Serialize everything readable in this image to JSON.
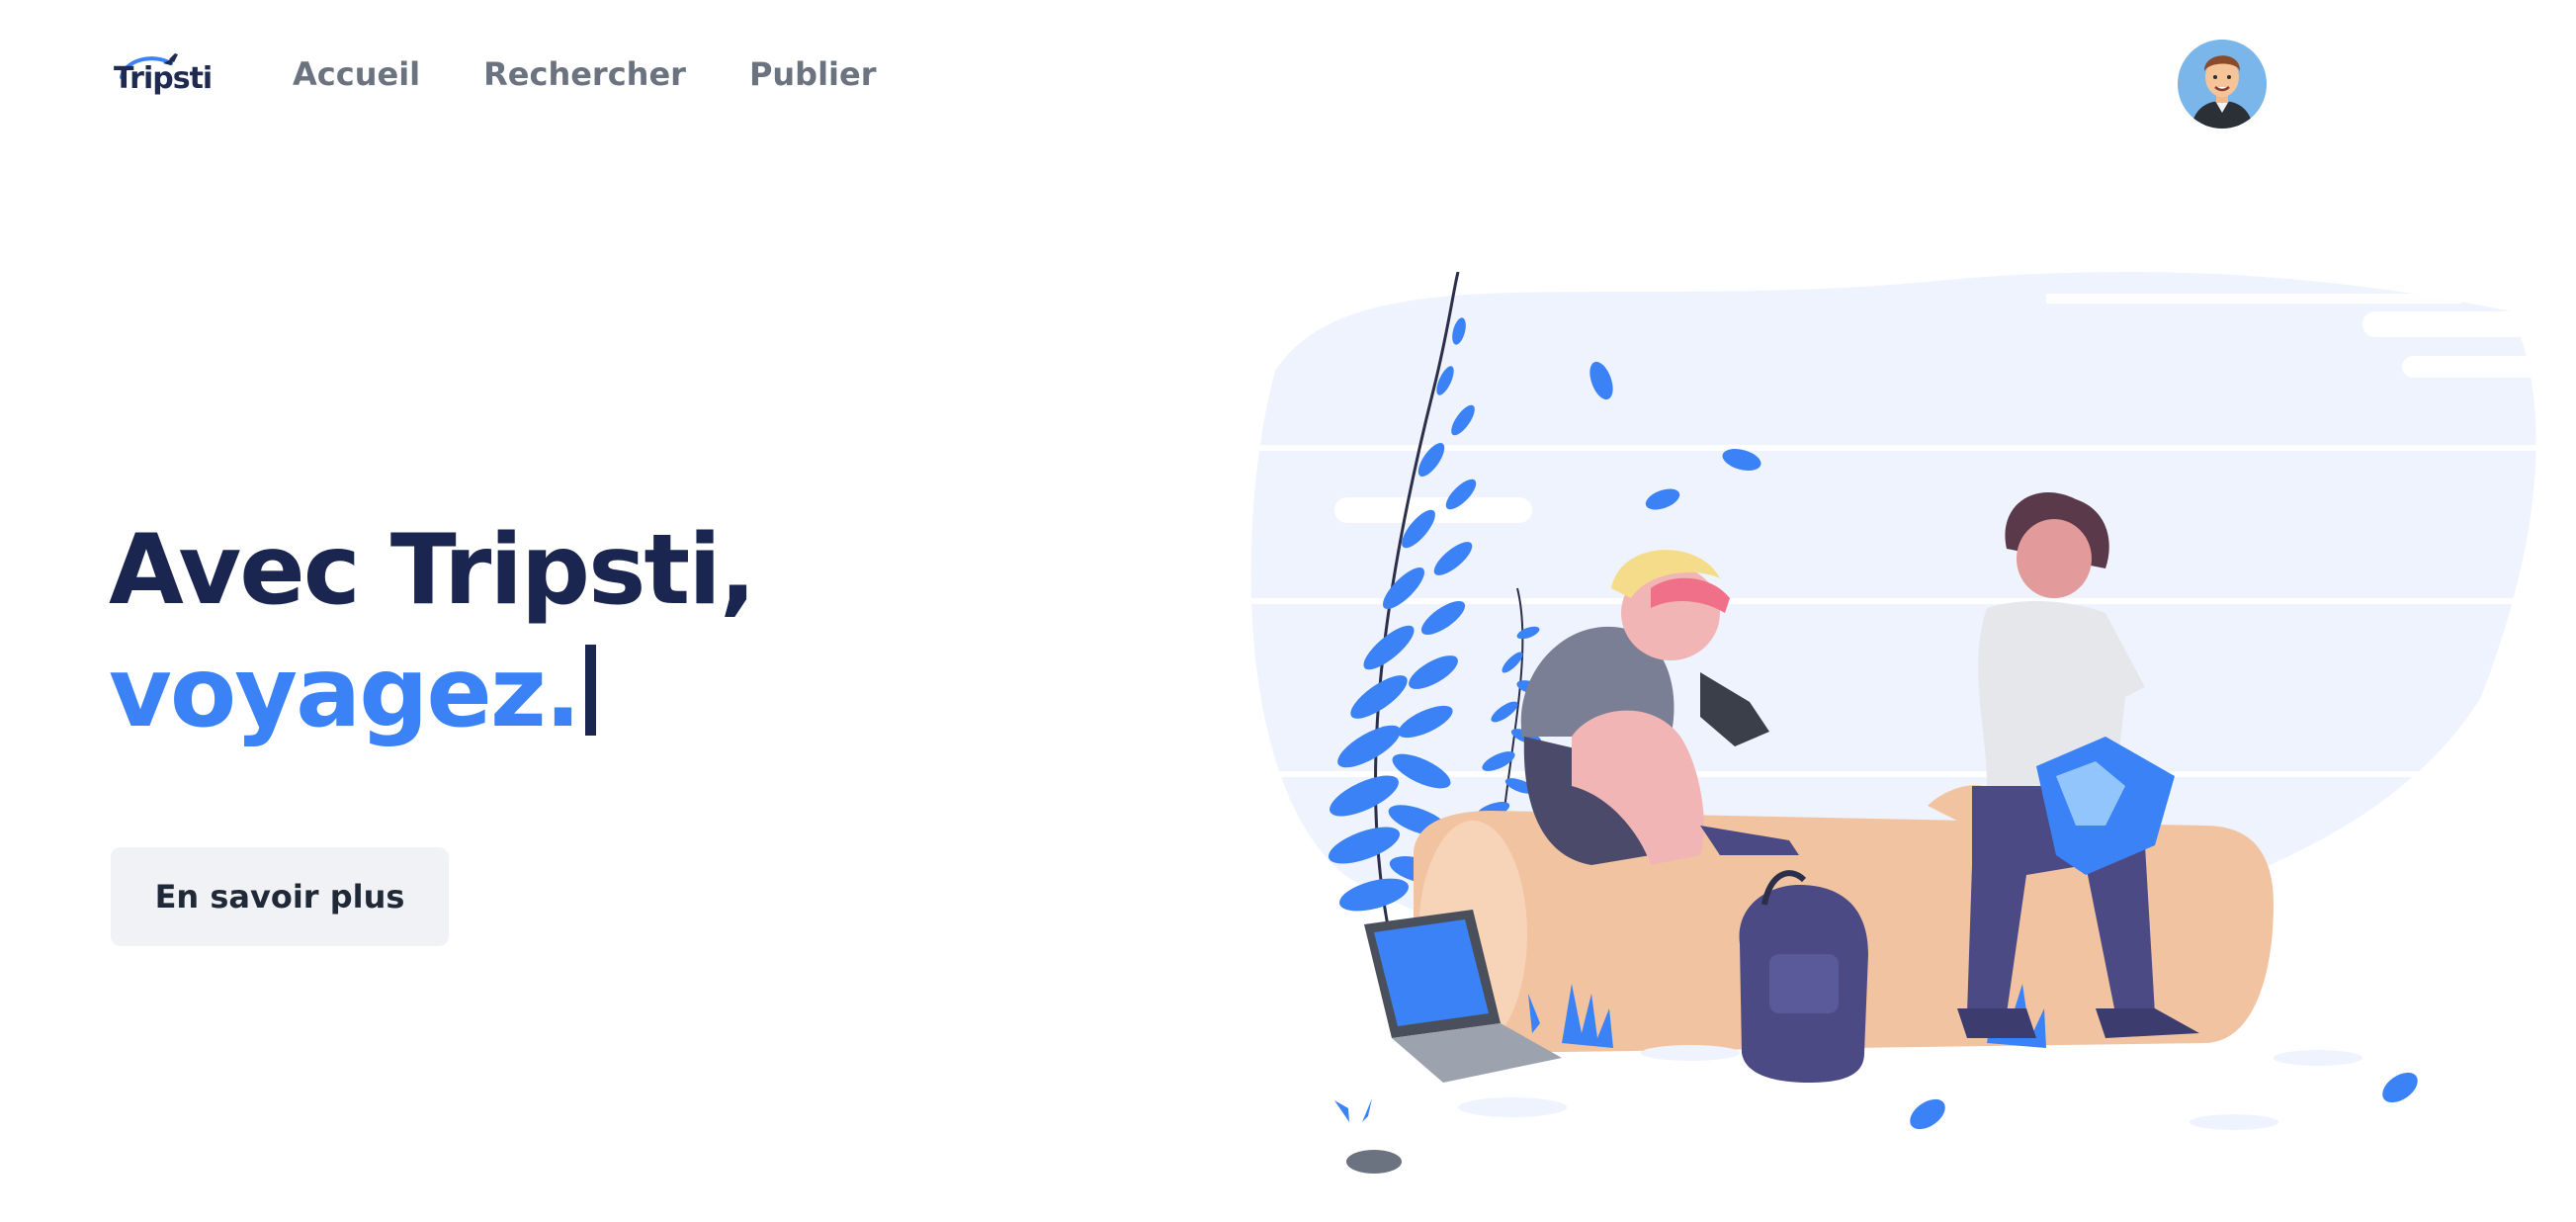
{
  "header": {
    "logo_text": "Tripsti",
    "nav": [
      {
        "label": "Accueil"
      },
      {
        "label": "Rechercher"
      },
      {
        "label": "Publier"
      }
    ]
  },
  "hero": {
    "title_line1": "Avec Tripsti,",
    "title_line2": "voyagez.",
    "cta_label": "En savoir plus"
  },
  "colors": {
    "primary": "#3b82f6",
    "heading": "#1a2550",
    "nav_text": "#6b7280",
    "button_bg": "#f1f2f5"
  },
  "icons": {
    "logo": "tripsti-logo-plane",
    "avatar": "user-avatar"
  }
}
